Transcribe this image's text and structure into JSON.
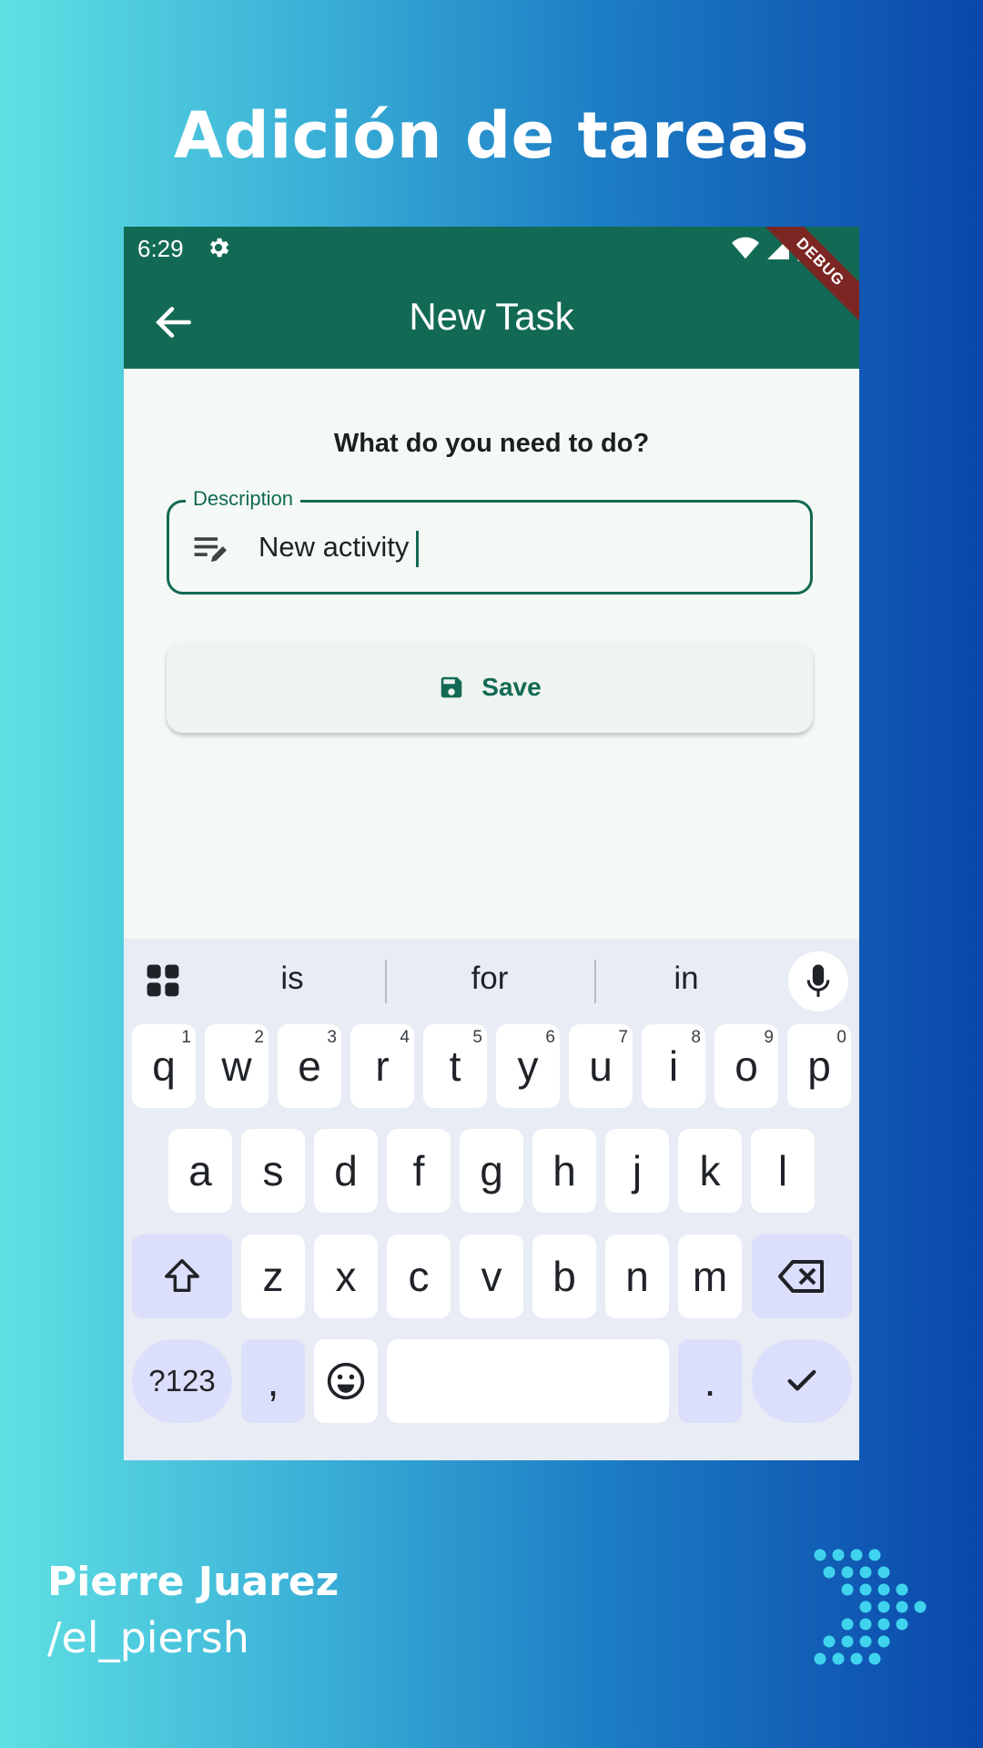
{
  "headline": "Adición de tareas",
  "status_bar": {
    "time": "6:29"
  },
  "app_bar": {
    "title": "New Task",
    "debug_banner": "DEBUG"
  },
  "form": {
    "prompt": "What do you need to do?",
    "description_label": "Description",
    "description_value": "New activity",
    "save_label": "Save"
  },
  "keyboard": {
    "suggestions": [
      "is",
      "for",
      "in"
    ],
    "row1": [
      {
        "k": "q",
        "n": "1"
      },
      {
        "k": "w",
        "n": "2"
      },
      {
        "k": "e",
        "n": "3"
      },
      {
        "k": "r",
        "n": "4"
      },
      {
        "k": "t",
        "n": "5"
      },
      {
        "k": "y",
        "n": "6"
      },
      {
        "k": "u",
        "n": "7"
      },
      {
        "k": "i",
        "n": "8"
      },
      {
        "k": "o",
        "n": "9"
      },
      {
        "k": "p",
        "n": "0"
      }
    ],
    "row2": [
      "a",
      "s",
      "d",
      "f",
      "g",
      "h",
      "j",
      "k",
      "l"
    ],
    "row3": [
      "z",
      "x",
      "c",
      "v",
      "b",
      "n",
      "m"
    ],
    "symbols_key": "?123",
    "comma_key": ",",
    "period_key": "."
  },
  "footer": {
    "author": "Pierre Juarez",
    "handle": "/el_piersh"
  },
  "colors": {
    "primary": "#126a54",
    "debug_ribbon": "#7c2624",
    "function_key": "#dcdffb",
    "logo": "#3fd3ee"
  },
  "icons": [
    "gear-icon",
    "wifi-icon",
    "signal-icon",
    "battery-icon",
    "back-arrow-icon",
    "notes-edit-icon",
    "save-disk-icon",
    "grid-apps-icon",
    "microphone-icon",
    "shift-icon",
    "backspace-icon",
    "emoji-icon",
    "check-icon"
  ]
}
